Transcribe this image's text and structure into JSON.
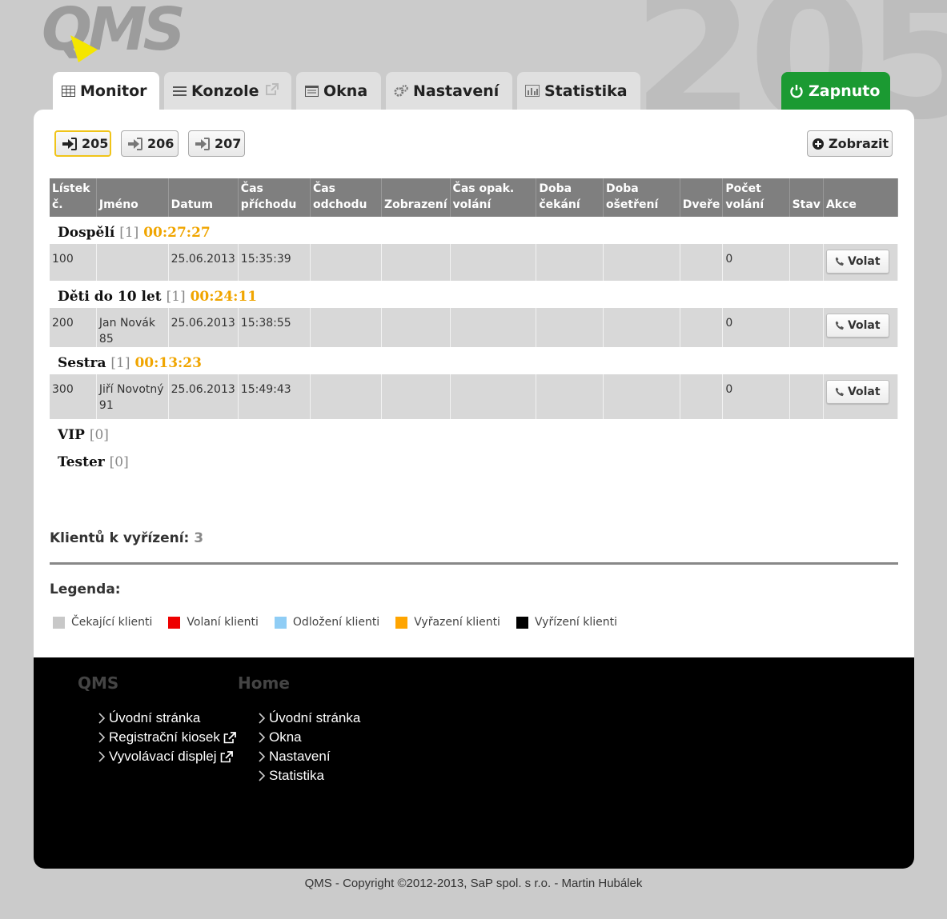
{
  "window_number_bg": "205",
  "logo": {
    "text": "QMS",
    "accent": "#f5e600"
  },
  "tabs": [
    {
      "label": "Monitor",
      "icon": "table-icon",
      "active": true
    },
    {
      "label": "Konzole",
      "icon": "list-icon",
      "external": true
    },
    {
      "label": "Okna",
      "icon": "window-icon"
    },
    {
      "label": "Nastavení",
      "icon": "gears-icon"
    },
    {
      "label": "Statistika",
      "icon": "bar-chart-icon"
    }
  ],
  "power": {
    "label": "Zapnuto",
    "color": "#1b9a32"
  },
  "windows": [
    {
      "label": "205",
      "selected": true
    },
    {
      "label": "206"
    },
    {
      "label": "207"
    }
  ],
  "show_button": "Zobrazit",
  "table": {
    "headers": [
      "Lístek č.",
      "Jméno",
      "Datum",
      "Čas příchodu",
      "Čas odchodu",
      "Zobrazení",
      "Čas opak. volání",
      "Doba čekání",
      "Doba ošetření",
      "Dveře",
      "Počet volání",
      "Stav",
      "Akce"
    ],
    "groups": [
      {
        "name": "Dospělí",
        "count": "[1]",
        "time": "00:27:27",
        "rows": [
          {
            "ticket": "100",
            "name": "",
            "date": "25.06.2013",
            "arrival": "15:35:39",
            "calls": "0"
          }
        ]
      },
      {
        "name": "Děti do 10 let",
        "count": "[1]",
        "time": "00:24:11",
        "rows": [
          {
            "ticket": "200",
            "name": "Jan Novák 85",
            "date": "25.06.2013",
            "arrival": "15:38:55",
            "calls": "0"
          }
        ]
      },
      {
        "name": "Sestra",
        "count": "[1]",
        "time": "00:13:23",
        "rows": [
          {
            "ticket": "300",
            "name": "Jiří Novotný 91",
            "date": "25.06.2013",
            "arrival": "15:49:43",
            "calls": "0"
          }
        ]
      },
      {
        "name": "VIP",
        "count": "[0]",
        "time": "",
        "rows": []
      },
      {
        "name": "Tester",
        "count": "[0]",
        "time": "",
        "rows": []
      }
    ],
    "call_button": "Volat"
  },
  "summary": {
    "label": "Klientů k vyřízení:",
    "value": "3"
  },
  "legend": {
    "title": "Legenda:",
    "items": [
      {
        "label": "Čekající klienti",
        "color": "#c8c8c8"
      },
      {
        "label": "Volaní klienti",
        "color": "#ee0000"
      },
      {
        "label": "Odložení klienti",
        "color": "#8fcdf5"
      },
      {
        "label": "Vyřazení klienti",
        "color": "#ffa500"
      },
      {
        "label": "Vyřízení klienti",
        "color": "#000000"
      }
    ]
  },
  "footer": {
    "columns": [
      {
        "title": "QMS",
        "links": [
          {
            "label": "Úvodní stránka"
          },
          {
            "label": "Registrační kiosek",
            "external": true
          },
          {
            "label": "Vyvolávací displej",
            "external": true
          }
        ]
      },
      {
        "title": "Home",
        "links": [
          {
            "label": "Úvodní stránka"
          },
          {
            "label": "Okna"
          },
          {
            "label": "Nastavení"
          },
          {
            "label": "Statistika"
          }
        ]
      }
    ]
  },
  "copyright": "QMS - Copyright ©2012-2013, SaP spol. s r.o. - Martin Hubálek"
}
